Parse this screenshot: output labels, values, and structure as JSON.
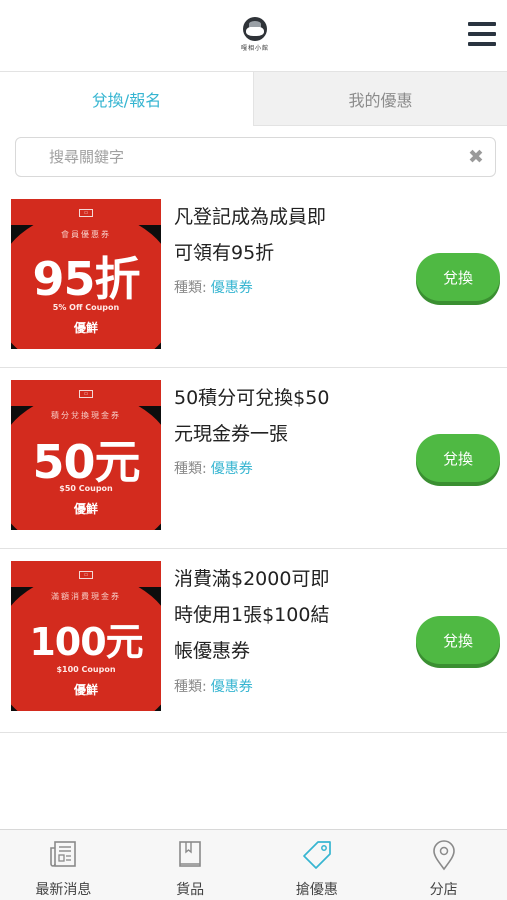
{
  "header": {
    "logo_text": "嘎相小館",
    "menu_icon": "hamburger-menu-icon"
  },
  "tabs": [
    {
      "label": "兌換/報名",
      "active": true
    },
    {
      "label": "我的優惠",
      "active": false
    }
  ],
  "search": {
    "placeholder": "搜尋關鍵字",
    "value": "",
    "clear_icon": "close-icon"
  },
  "coupons": [
    {
      "image": {
        "kicker": "會員優惠券",
        "big": "95折",
        "sub": "5% Off Coupon",
        "brand": "優鮮"
      },
      "title_line1": "凡登記成為成員即",
      "title_line2": "可領有95折",
      "title_line3": "",
      "type_label": "種類:",
      "type_value": "優惠券",
      "button": "兌換"
    },
    {
      "image": {
        "kicker": "積分兌換現金券",
        "big": "50元",
        "sub": "$50 Coupon",
        "brand": "優鮮"
      },
      "title_line1": "50積分可兌換$50",
      "title_line2": "元現金券一張",
      "title_line3": "",
      "type_label": "種類:",
      "type_value": "優惠券",
      "button": "兌換"
    },
    {
      "image": {
        "kicker": "滿額消費現金券",
        "big": "100元",
        "sub": "$100 Coupon",
        "brand": "優鮮"
      },
      "title_line1": "消費滿$2000可即",
      "title_line2": "時使用1張$100結",
      "title_line3": "帳優惠券",
      "type_label": "種類:",
      "type_value": "優惠券",
      "button": "兌換"
    }
  ],
  "bottom_nav": [
    {
      "label": "最新消息",
      "icon": "newspaper-icon",
      "active": false
    },
    {
      "label": "貨品",
      "icon": "book-icon",
      "active": false
    },
    {
      "label": "搶優惠",
      "icon": "tag-icon",
      "active": true
    },
    {
      "label": "分店",
      "icon": "map-pin-icon",
      "active": false
    }
  ],
  "colors": {
    "accent": "#36b5d1",
    "button_green": "#4fb943",
    "coupon_red": "#d32b1e"
  }
}
